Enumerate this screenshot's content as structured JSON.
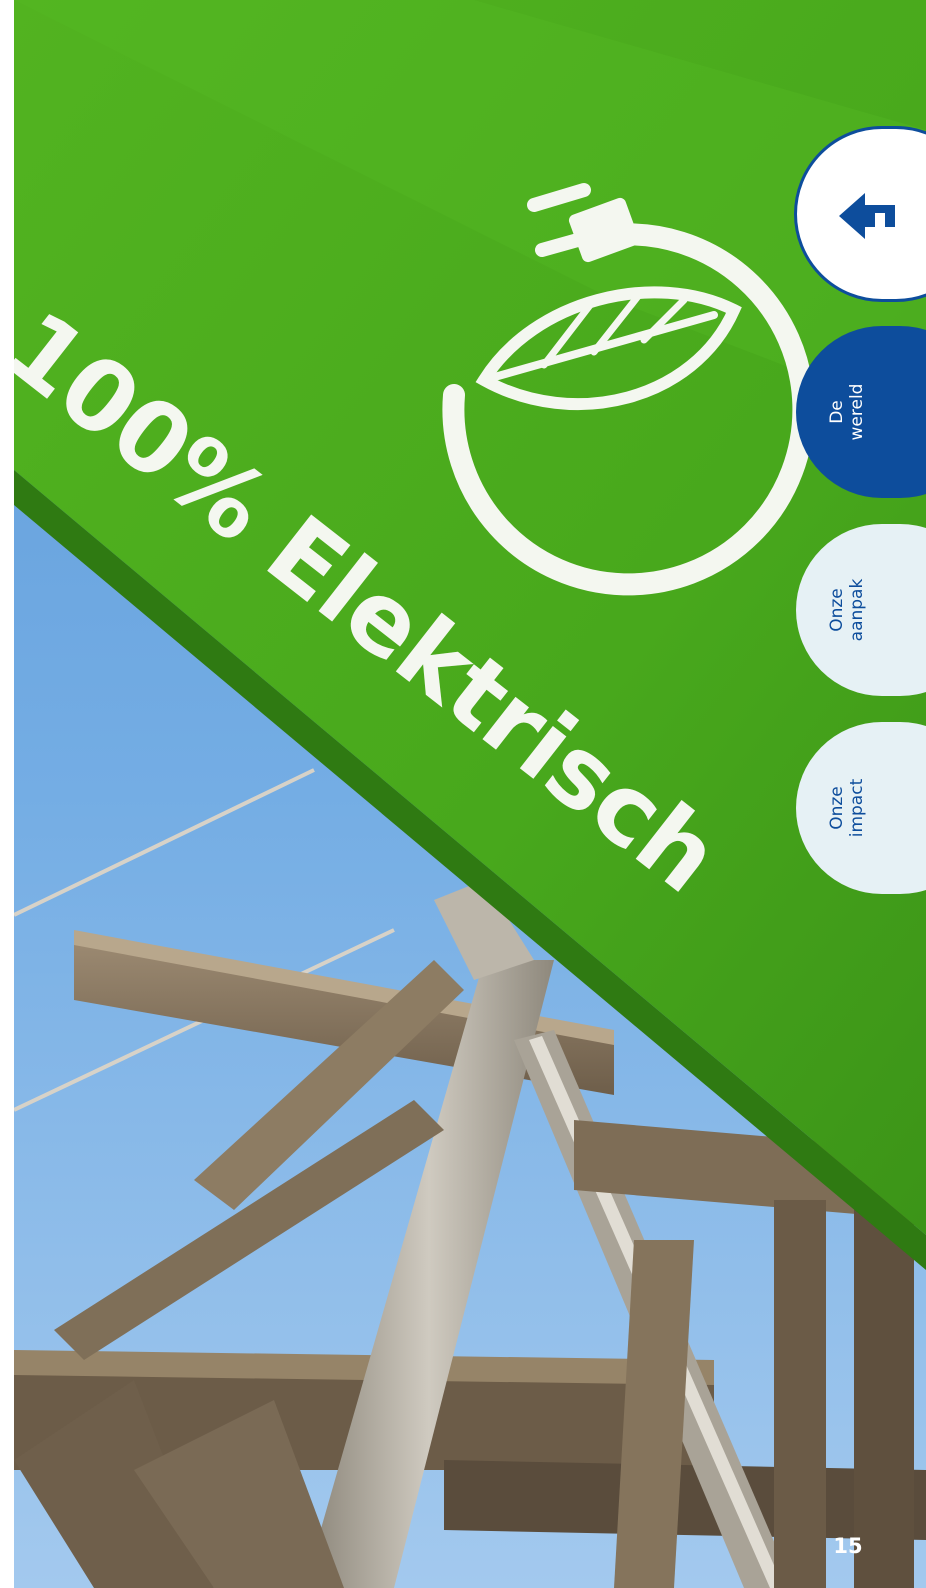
{
  "sign": {
    "text": "100% Elektrisch",
    "icon": "leaf-plug-icon"
  },
  "nav": {
    "home_icon": "house-icon",
    "tabs": [
      {
        "line1": "De",
        "line2": "wereld",
        "active": true
      },
      {
        "line1": "Onze",
        "line2": "aanpak",
        "active": false
      },
      {
        "line1": "Onze",
        "line2": "impact",
        "active": false
      }
    ]
  },
  "page_number": "15",
  "colors": {
    "sign_green": "#4caf1e",
    "sky_blue": "#6ea8e0",
    "nav_blue": "#0d4d9c",
    "nav_inactive": "#e6f1f5"
  }
}
